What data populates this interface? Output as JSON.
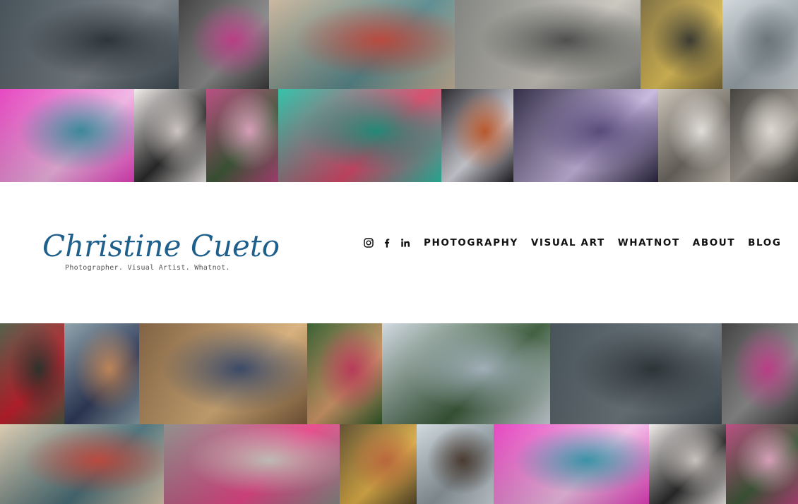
{
  "site": {
    "logo_script": "Christine Cueto",
    "logo_tagline": "Photographer. Visual Artist. Whatnot."
  },
  "nav": {
    "social": [
      {
        "name": "instagram-icon"
      },
      {
        "name": "facebook-icon"
      },
      {
        "name": "linkedin-icon"
      }
    ],
    "links": [
      "PHOTOGRAPHY",
      "VISUAL ART",
      "WHATNOT",
      "ABOUT",
      "BLOG"
    ]
  },
  "colors": {
    "logo_blue": "#1f5f8b",
    "nav_text": "#111111",
    "background": "#ffffff"
  },
  "gallery_top": [
    [
      "woman-in-water-photo",
      "mannequin-art-photo",
      "birdhouses-couple-photo",
      "sculpted-mannequins-photo",
      "yellow-gown-photo",
      "window-portrait-photo"
    ],
    [
      "underwater-pink-photo",
      "queen-card-portrait-photo",
      "flower-portrait-photo",
      "teal-flowers-portrait-photo",
      "white-costume-photo",
      "underwater-dancer-photo",
      "staircase-fashion-photo",
      "house-group-photo"
    ]
  ],
  "gallery_bottom": [
    [
      "red-gown-photo",
      "street-couple-photo",
      "beach-couple-photo",
      "flower-crown-photo",
      "palace-couple-photo",
      "woman-in-water-photo-2",
      "mannequin-art-photo-2"
    ],
    [
      "birdhouses-couple-photo-2",
      "sculpted-mannequins-photo-2",
      "flower-crown-photo-2",
      "window-portrait-photo-2",
      "underwater-pink-photo-2",
      "queen-card-portrait-photo-2",
      "flower-portrait-photo-2"
    ]
  ]
}
